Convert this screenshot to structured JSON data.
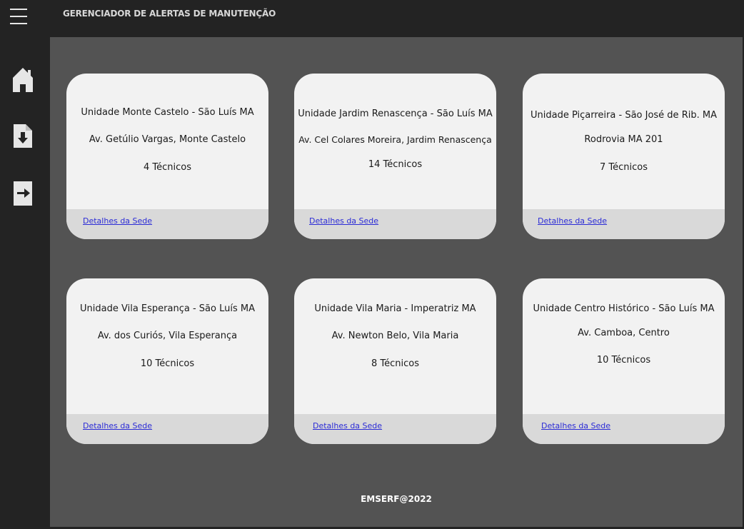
{
  "header": {
    "title": "GERENCIADOR DE ALERTAS DE MANUTENÇÃO",
    "menu_icon": "hamburger-menu-icon"
  },
  "sidebar": {
    "items": [
      {
        "icon": "home-icon"
      },
      {
        "icon": "download-file-icon"
      },
      {
        "icon": "logout-arrow-icon"
      }
    ]
  },
  "cards": [
    {
      "name": "Unidade Monte Castelo - São Luís MA",
      "address": "Av. Getúlio Vargas, Monte Castelo",
      "technicians": "4 Técnicos",
      "link": "Detalhes da Sede"
    },
    {
      "name": "Unidade Jardim Renascença - São Luís MA",
      "address": "Av. Cel Colares Moreira, Jardim Renascença",
      "technicians": "14 Técnicos",
      "link": "Detalhes da Sede"
    },
    {
      "name": "Unidade Piçarreira - São José de Rib. MA",
      "address": "Rodrovia MA 201",
      "technicians": "7 Técnicos",
      "link": "Detalhes da Sede"
    },
    {
      "name": "Unidade Vila Esperança - São Luís MA",
      "address": "Av. dos Curiós, Vila Esperança",
      "technicians": "10 Técnicos",
      "link": "Detalhes da Sede"
    },
    {
      "name": "Unidade Vila Maria - Imperatriz MA",
      "address": "Av. Newton Belo, Vila Maria",
      "technicians": "8 Técnicos",
      "link": "Detalhes da Sede"
    },
    {
      "name": "Unidade Centro Histórico - São Luís MA",
      "address": "Av. Camboa, Centro",
      "technicians": "10 Técnicos",
      "link": "Detalhes da Sede"
    }
  ],
  "footer": {
    "text": "EMSERF@2022"
  },
  "colors": {
    "chrome": "#232323",
    "main_bg": "#535353",
    "card_bg": "#f2f2f2",
    "card_footer_bg": "#d9d9d9",
    "link": "#2b2bd6"
  }
}
